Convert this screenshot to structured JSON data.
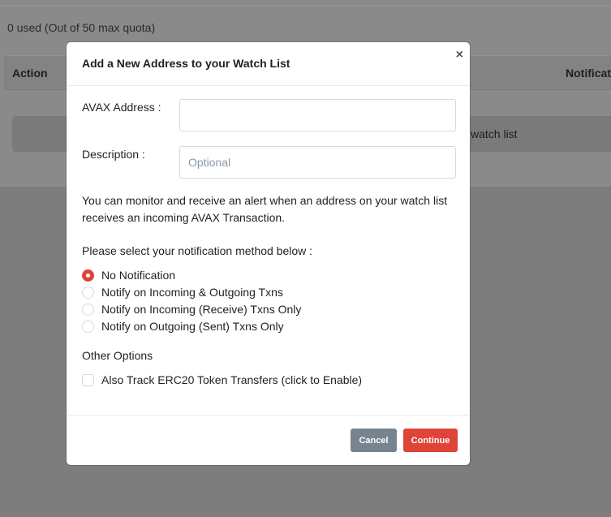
{
  "background": {
    "quota_text": "0 used (Out of 50 max quota)",
    "table_headers": {
      "action": "Action",
      "notification": "Notificat"
    },
    "empty_row_text": "watch list"
  },
  "modal": {
    "title": "Add a New Address to your Watch List",
    "close_symbol": "×",
    "avax_label": "AVAX Address :",
    "avax_value": "",
    "description_label": "Description :",
    "description_placeholder": "Optional",
    "info_text": "You can monitor and receive an alert when an address on your watch list receives an incoming AVAX Transaction.",
    "notification_prompt": "Please select your notification method below :",
    "notification_options": [
      {
        "label": "No Notification",
        "checked": true
      },
      {
        "label": "Notify on Incoming & Outgoing Txns",
        "checked": false
      },
      {
        "label": "Notify on Incoming (Receive) Txns Only",
        "checked": false
      },
      {
        "label": "Notify on Outgoing (Sent) Txns Only",
        "checked": false
      }
    ],
    "other_options_heading": "Other Options",
    "erc20_label": "Also Track ERC20 Token Transfers (click to Enable)",
    "erc20_checked": false,
    "cancel_label": "Cancel",
    "continue_label": "Continue"
  },
  "colors": {
    "accent_red": "#de4437",
    "cancel_gray": "#77838f",
    "overlay": "#7d7d7d"
  }
}
